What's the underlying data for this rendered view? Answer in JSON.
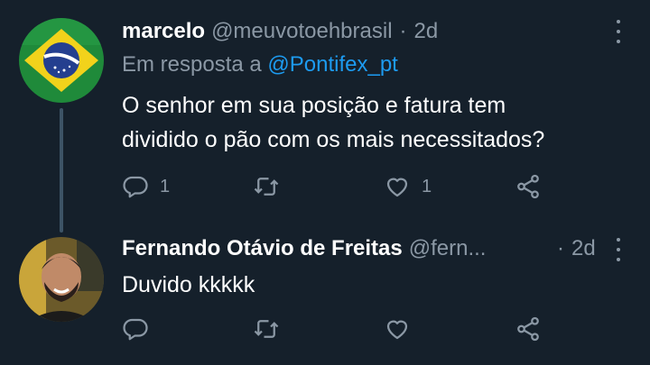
{
  "tweets": [
    {
      "name": "marcelo",
      "handle": "@meuvotoehbrasil",
      "separator": "·",
      "time": "2d",
      "reply_prefix": "Em resposta a",
      "reply_mention": "@Pontifex_pt",
      "text_line1": "O senhor em sua posição e fatura tem",
      "text_line2": "dividido o pão com os mais necessitados?",
      "reply_count": "1",
      "retweet_count": "",
      "like_count": "1",
      "avatar_icon": "brazil-flag-avatar"
    },
    {
      "name": "Fernando Otávio de Freitas",
      "handle": "@fern...",
      "separator": "·",
      "time": "2d",
      "text": "Duvido kkkkk",
      "reply_count": "",
      "retweet_count": "",
      "like_count": "",
      "avatar_icon": "person-photo-avatar"
    }
  ],
  "colors": {
    "background": "#15202b",
    "text_primary": "#ffffff",
    "text_secondary": "#8b98a5",
    "link": "#1d9bf0",
    "thread_line": "#3d5466"
  }
}
